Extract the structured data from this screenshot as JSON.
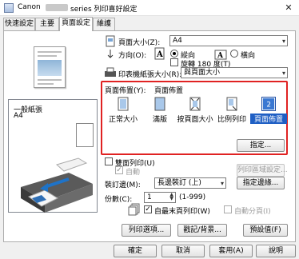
{
  "window": {
    "title_prefix": "Canon",
    "title_suffix": "series 列印喜好設定",
    "close_glyph": "✕"
  },
  "tabs": [
    {
      "label": "快速設定"
    },
    {
      "label": "主要"
    },
    {
      "label": "頁面設定"
    },
    {
      "label": "維護"
    }
  ],
  "preview": {
    "paper_name": "一般紙張",
    "paper_size": "A4"
  },
  "page_size": {
    "label": "頁面大小(Z):",
    "value": "A4"
  },
  "orientation": {
    "label": "方向(O):",
    "portrait": "縱向",
    "landscape": "橫向",
    "rotate": "旋轉 180 度(T)"
  },
  "printer_paper": {
    "label": "印表機紙張大小(R):",
    "value": "與頁面大小"
  },
  "layout": {
    "label": "頁面佈置(Y):",
    "current": "頁面佈置",
    "items": [
      {
        "label": "正常大小"
      },
      {
        "label": "滿版"
      },
      {
        "label": "按頁面大小"
      },
      {
        "label": "比例列印"
      },
      {
        "label": "頁面佈置",
        "selected": true,
        "badge": "2"
      }
    ],
    "specify_button": "指定..."
  },
  "duplex": {
    "label": "雙面列印(U)",
    "auto_label": "自動",
    "area_button": "列印區域設定..."
  },
  "binding": {
    "label": "裝訂邊(M):",
    "value": "長邊裝訂 (上)",
    "margin_button": "指定邊緣..."
  },
  "copies": {
    "label": "份數(C):",
    "value": "1",
    "range": "(1-999)",
    "last_page_first": "自最末頁列印(W)",
    "collate": "自動分頁(I)"
  },
  "bottom_buttons": {
    "print_options": "列印選項...",
    "stamp": "戳記/背景...",
    "defaults": "預設值(F)"
  },
  "dialog_buttons": {
    "ok": "確定",
    "cancel": "取消",
    "apply": "套用(A)",
    "help": "說明"
  },
  "colors": {
    "highlight_border": "#e02222",
    "selection": "#1f5fc4"
  }
}
